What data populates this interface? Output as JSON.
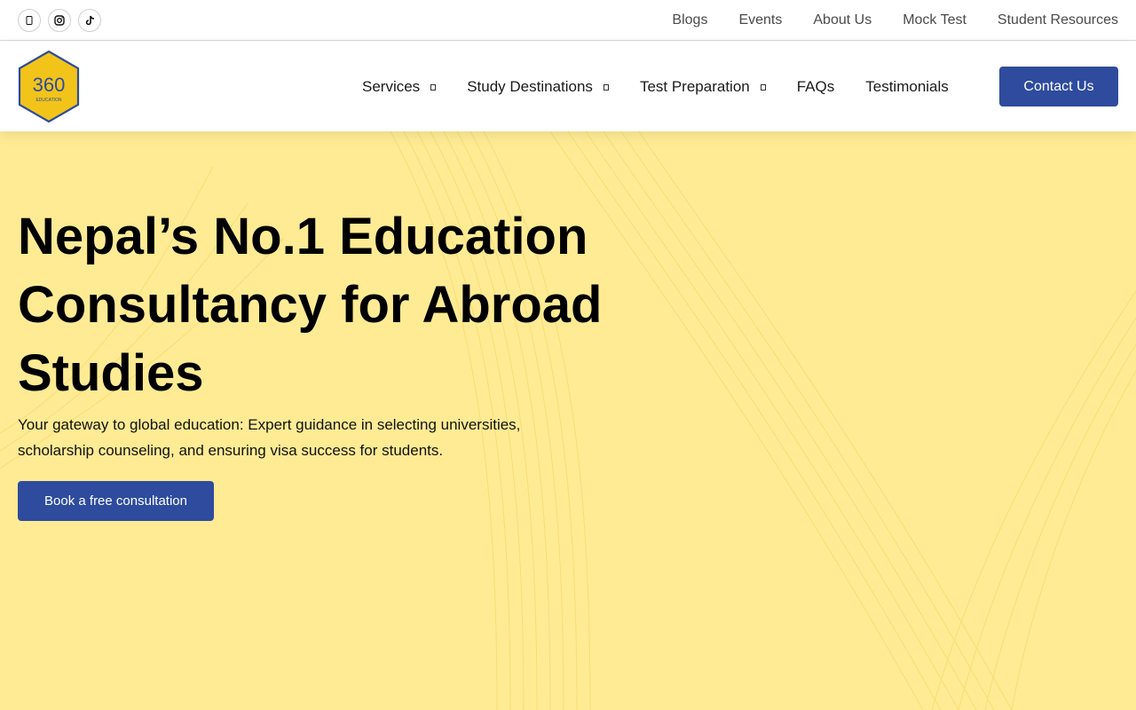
{
  "topbar": {
    "social": [
      {
        "icon": "mobile-icon"
      },
      {
        "icon": "instagram-icon"
      },
      {
        "icon": "tiktok-icon"
      }
    ],
    "links": [
      "Blogs",
      "Events",
      "About Us",
      "Mock Test",
      "Student Resources"
    ]
  },
  "header": {
    "logo": {
      "number": "360",
      "subtext": "EDUCATION"
    },
    "nav": [
      {
        "label": "Services",
        "has_dropdown": true
      },
      {
        "label": "Study Destinations",
        "has_dropdown": true
      },
      {
        "label": "Test Preparation",
        "has_dropdown": true
      },
      {
        "label": "FAQs",
        "has_dropdown": false
      },
      {
        "label": "Testimonials",
        "has_dropdown": false
      }
    ],
    "contact_label": "Contact Us"
  },
  "hero": {
    "title": "Nepal’s No.1 Education Consultancy for Abroad Studies",
    "subtitle": "Your gateway to global education: Expert guidance in selecting universities, scholarship counseling, and ensuring visa success for students.",
    "cta_label": "Book a free consultation"
  },
  "colors": {
    "brand_blue": "#2e4b9e",
    "hero_yellow": "#feeb94",
    "logo_yellow": "#f2c419"
  }
}
